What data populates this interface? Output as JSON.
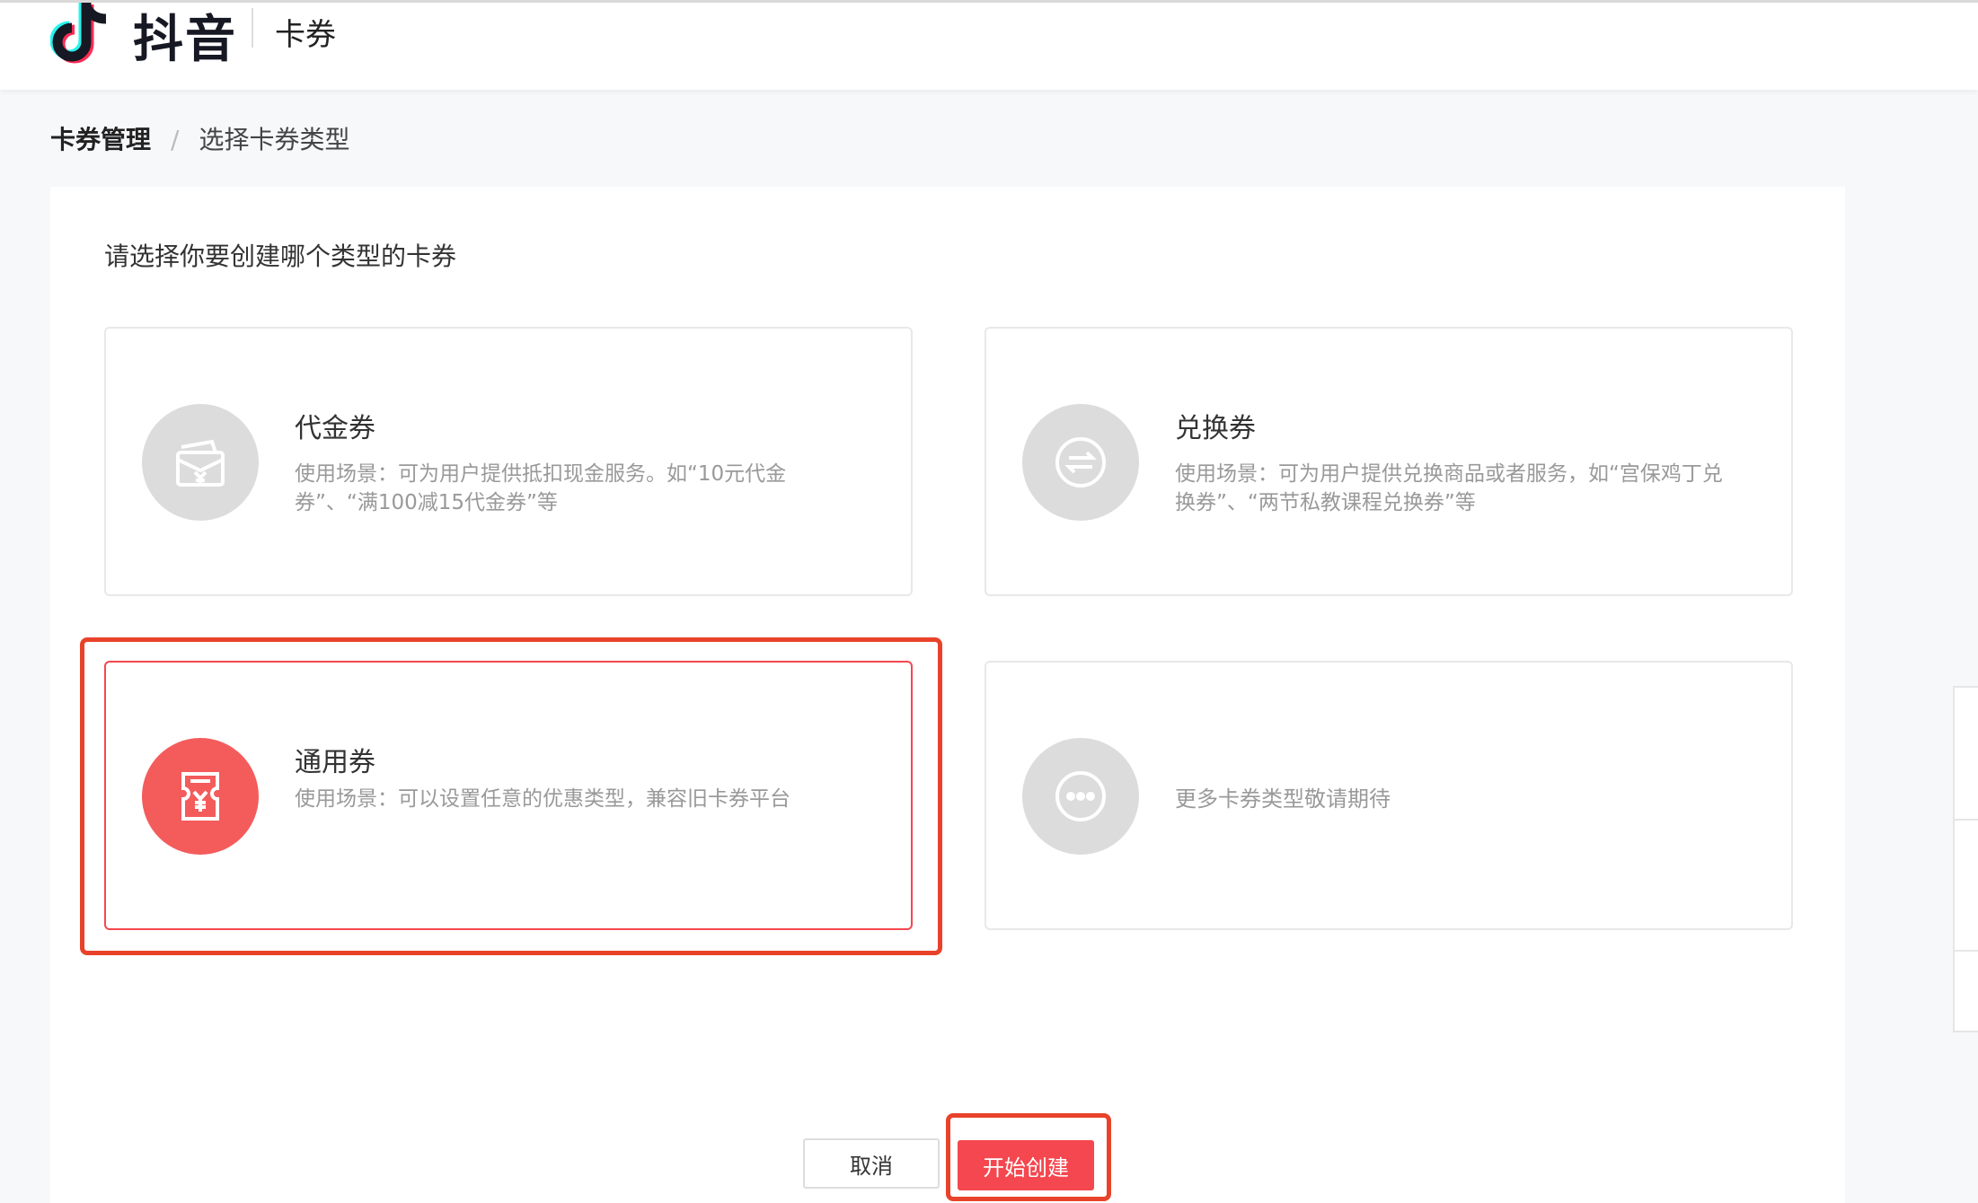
{
  "header": {
    "brand": "抖音",
    "product": "卡券"
  },
  "breadcrumb": {
    "root": "卡券管理",
    "separator": "/",
    "current": "选择卡券类型"
  },
  "prompt": "请选择你要创建哪个类型的卡券",
  "cards": [
    {
      "title": "代金券",
      "desc": "使用场景：可为用户提供抵扣现金服务。如“10元代金券”、“满100减15代金券”等",
      "icon": "wallet-yen-icon",
      "selected": false
    },
    {
      "title": "兑换券",
      "desc": "使用场景：可为用户提供兑换商品或者服务，如“宫保鸡丁兑换券”、“两节私教课程兑换券”等",
      "icon": "exchange-icon",
      "selected": false
    },
    {
      "title": "通用券",
      "desc": "使用场景：可以设置任意的优惠类型，兼容旧卡券平台",
      "icon": "ticket-yen-icon",
      "selected": true
    },
    {
      "title": "",
      "desc": "更多卡券类型敬请期待",
      "icon": "more-dots-icon",
      "selected": false
    }
  ],
  "actions": {
    "cancel": "取消",
    "create": "开始创建"
  },
  "colors": {
    "accent": "#f4474f",
    "highlight": "#e8432a",
    "icon_grey": "#dcdcdc"
  }
}
